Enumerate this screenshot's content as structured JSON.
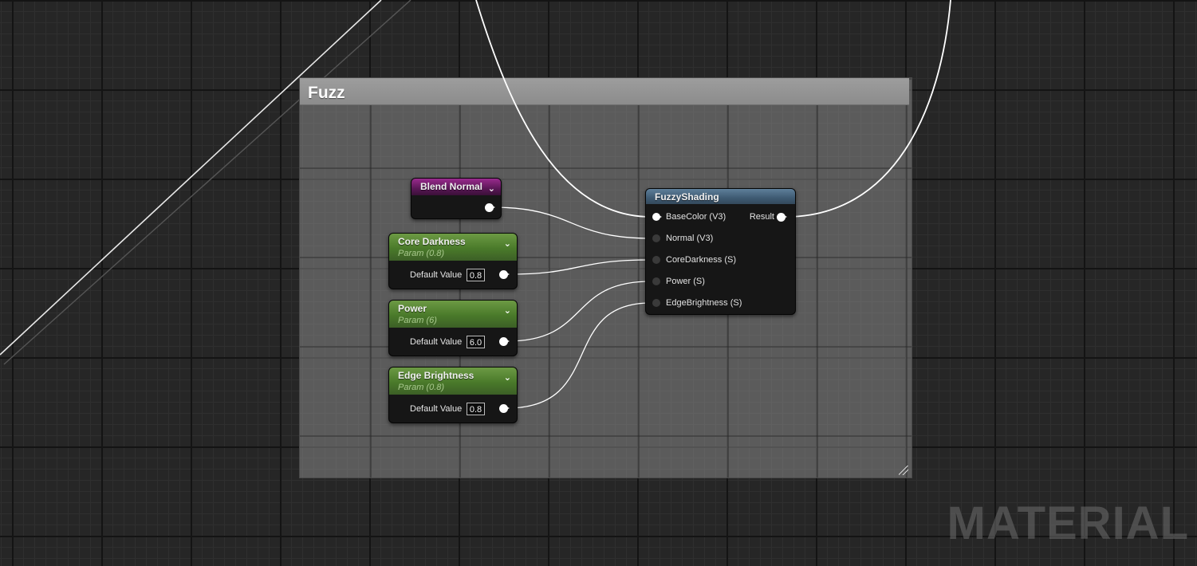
{
  "comment": {
    "title": "Fuzz"
  },
  "nodes": {
    "blend_normal": {
      "title": "Blend Normal"
    },
    "core_darkness": {
      "title": "Core Darkness",
      "subtitle": "Param (0.8)",
      "default_label": "Default Value",
      "default_value": "0.8"
    },
    "power": {
      "title": "Power",
      "subtitle": "Param (6)",
      "default_label": "Default Value",
      "default_value": "6.0"
    },
    "edge_brightness": {
      "title": "Edge Brightness",
      "subtitle": "Param (0.8)",
      "default_label": "Default Value",
      "default_value": "0.8"
    },
    "fuzzy_shading": {
      "title": "FuzzyShading",
      "inputs": [
        "BaseColor (V3)",
        "Normal (V3)",
        "CoreDarkness (S)",
        "Power (S)",
        "EdgeBrightness (S)"
      ],
      "output": "Result"
    }
  },
  "watermark": "MATERIAL",
  "colors": {
    "background": "#262626",
    "function_header": "#3e5a72",
    "param_header": "#4a7a2a",
    "blend_header": "#5a1756",
    "wire": "#ffffff"
  }
}
